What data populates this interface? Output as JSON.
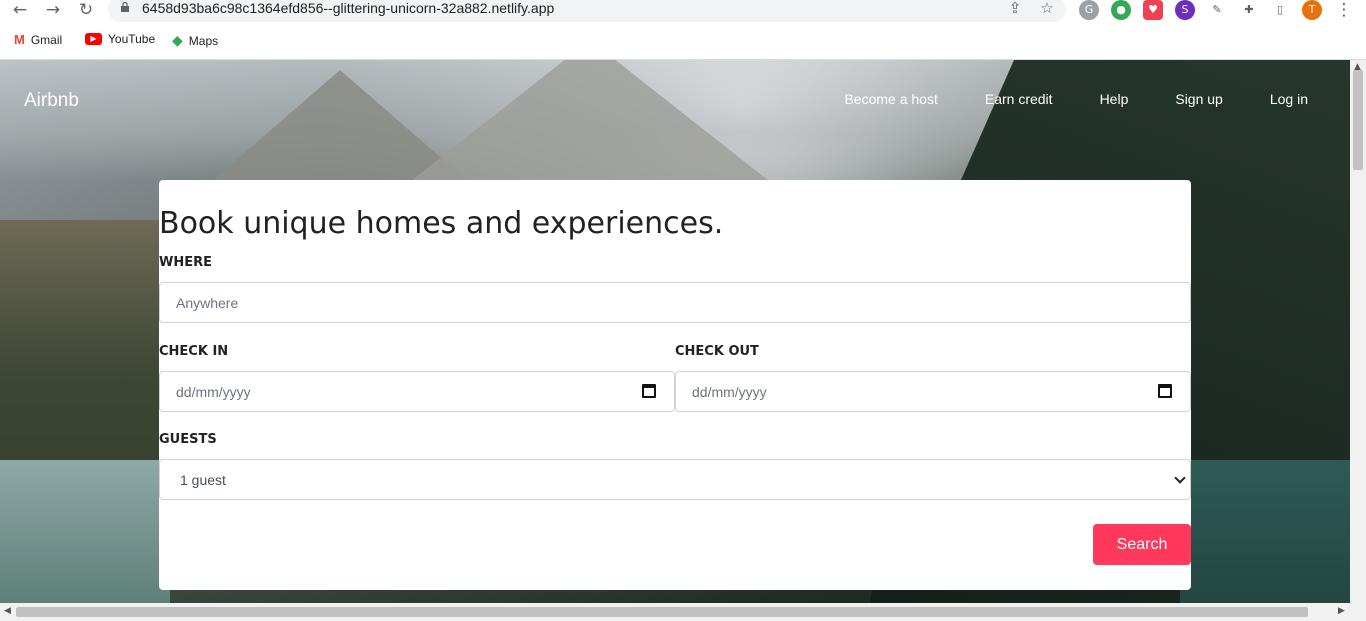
{
  "browser": {
    "url": "6458d93ba6c98c1364efd856--glittering-unicorn-32a882.netlify.app",
    "profile_initial": "T",
    "bookmarks": [
      {
        "label": "Gmail",
        "icon": "gmail-icon"
      },
      {
        "label": "YouTube",
        "icon": "youtube-icon"
      },
      {
        "label": "Maps",
        "icon": "maps-icon"
      }
    ]
  },
  "site": {
    "brand": "Airbnb",
    "nav": [
      "Become a host",
      "Earn credit",
      "Help",
      "Sign up",
      "Log in"
    ]
  },
  "form": {
    "headline": "Book unique homes and experiences.",
    "where_label": "WHERE",
    "where_placeholder": "Anywhere",
    "checkin_label": "CHECK IN",
    "checkin_placeholder": "dd/mm/yyyy",
    "checkout_label": "CHECK OUT",
    "checkout_placeholder": "dd/mm/yyyy",
    "guests_label": "GUESTS",
    "guests_value": "1 guest",
    "search_label": "Search"
  },
  "colors": {
    "accent": "#ff385c",
    "text": "#222222"
  }
}
